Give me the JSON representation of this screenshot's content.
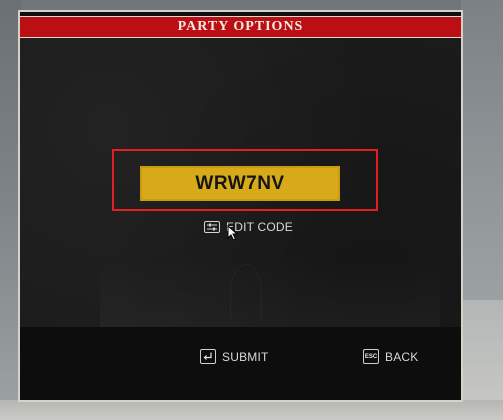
{
  "dialog": {
    "title": "PARTY OPTIONS"
  },
  "party_code": {
    "value": "WRW7NV"
  },
  "edit_code": {
    "label": "EDIT CODE",
    "icon": "edit-keybind-icon"
  },
  "footer": {
    "submit": {
      "label": "SUBMIT",
      "icon": "enter-key-icon"
    },
    "back": {
      "label": "BACK",
      "key": "ESC",
      "icon": "esc-key-icon"
    }
  },
  "colors": {
    "title_bar": "#bc0f15",
    "code_background": "#d7aa19",
    "highlight_outline": "#e31f25",
    "panel": "#1b1b1b"
  }
}
